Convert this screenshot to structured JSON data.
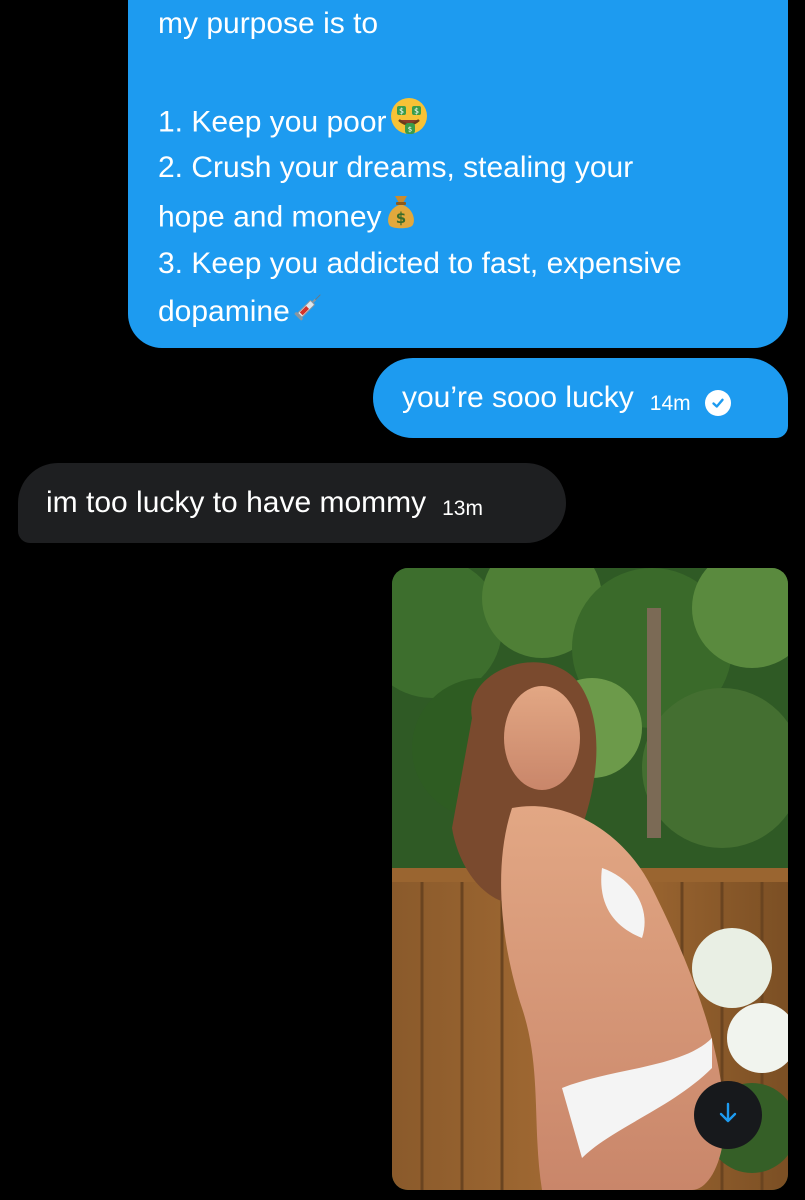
{
  "messages": [
    {
      "direction": "received",
      "lines": [
        "my purpose is to",
        "",
        "1. Keep you poor",
        "2. Crush your dreams, stealing your",
        "hope and money",
        "3. Keep you addicted to fast, expensive",
        "dopamine"
      ],
      "inline_emoji_icons": [
        "money-mouth-face-icon",
        "money-bag-icon",
        "syringe-icon"
      ]
    },
    {
      "direction": "sent",
      "text": "you’re sooo lucky",
      "time": "14m",
      "status_icon": "read-check-icon"
    },
    {
      "direction": "received",
      "text": "im too lucky to have mommy",
      "time": "13m"
    },
    {
      "direction": "sent",
      "type": "image"
    }
  ],
  "scroll_button": {
    "icon": "arrow-down-icon"
  },
  "colors": {
    "background": "#000000",
    "sent_bubble": "#1d9bf0",
    "received_bubble": "#1e1f21",
    "text": "#ffffff",
    "accent": "#1d9bf0"
  }
}
